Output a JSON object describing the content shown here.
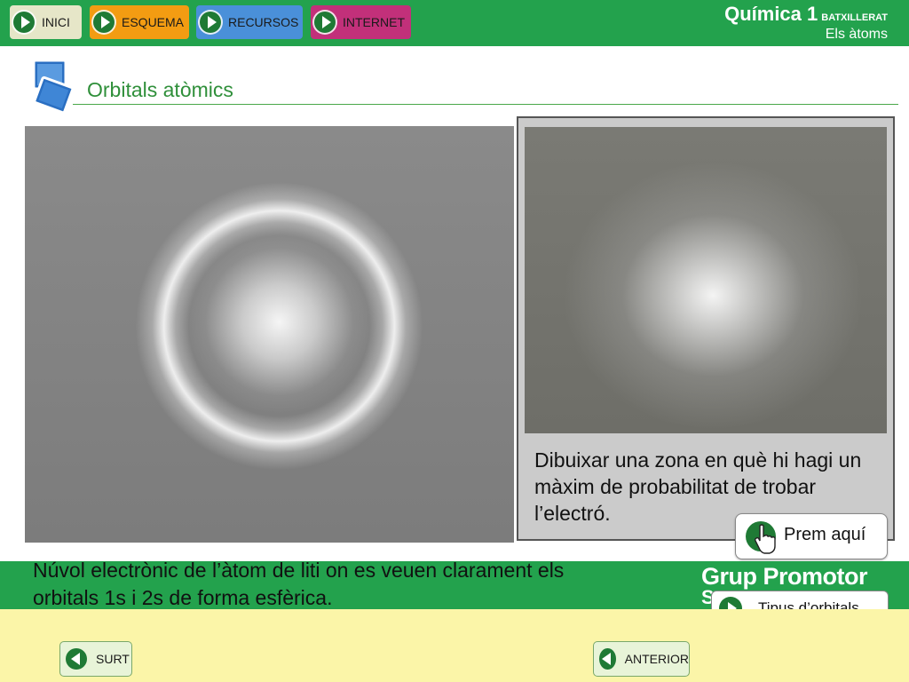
{
  "nav": {
    "items": [
      {
        "label": "INICI",
        "color": "#e6e6c8"
      },
      {
        "label": "ESQUEMA",
        "color": "#f39c12"
      },
      {
        "label": "RECURSOS",
        "color": "#4a90d9"
      },
      {
        "label": "INTERNET",
        "color": "#c2307a"
      }
    ]
  },
  "header": {
    "course": "Química 1",
    "level": "BATXILLERAT",
    "unit": "Els àtoms"
  },
  "page": {
    "title": "Orbitals atòmics"
  },
  "panel": {
    "text": "Dibuixar una zona en què hi hagi un màxim de probabilitat de trobar l’electró.",
    "button_label": "Prem aquí"
  },
  "caption": "Núvol electrònic de l’àtom de liti on es veuen clarament els orbitals 1s i 2s de forma esfèrica.",
  "brand": {
    "name": "Grup Promotor",
    "partial": "S"
  },
  "links": {
    "tipus_label": "Tipus d’orbitals"
  },
  "footer": {
    "surt_label": "SURT",
    "anterior_label": "ANTERIOR"
  },
  "colors": {
    "accent_green": "#23a24d",
    "bottom_yellow": "#fbf5a8"
  }
}
